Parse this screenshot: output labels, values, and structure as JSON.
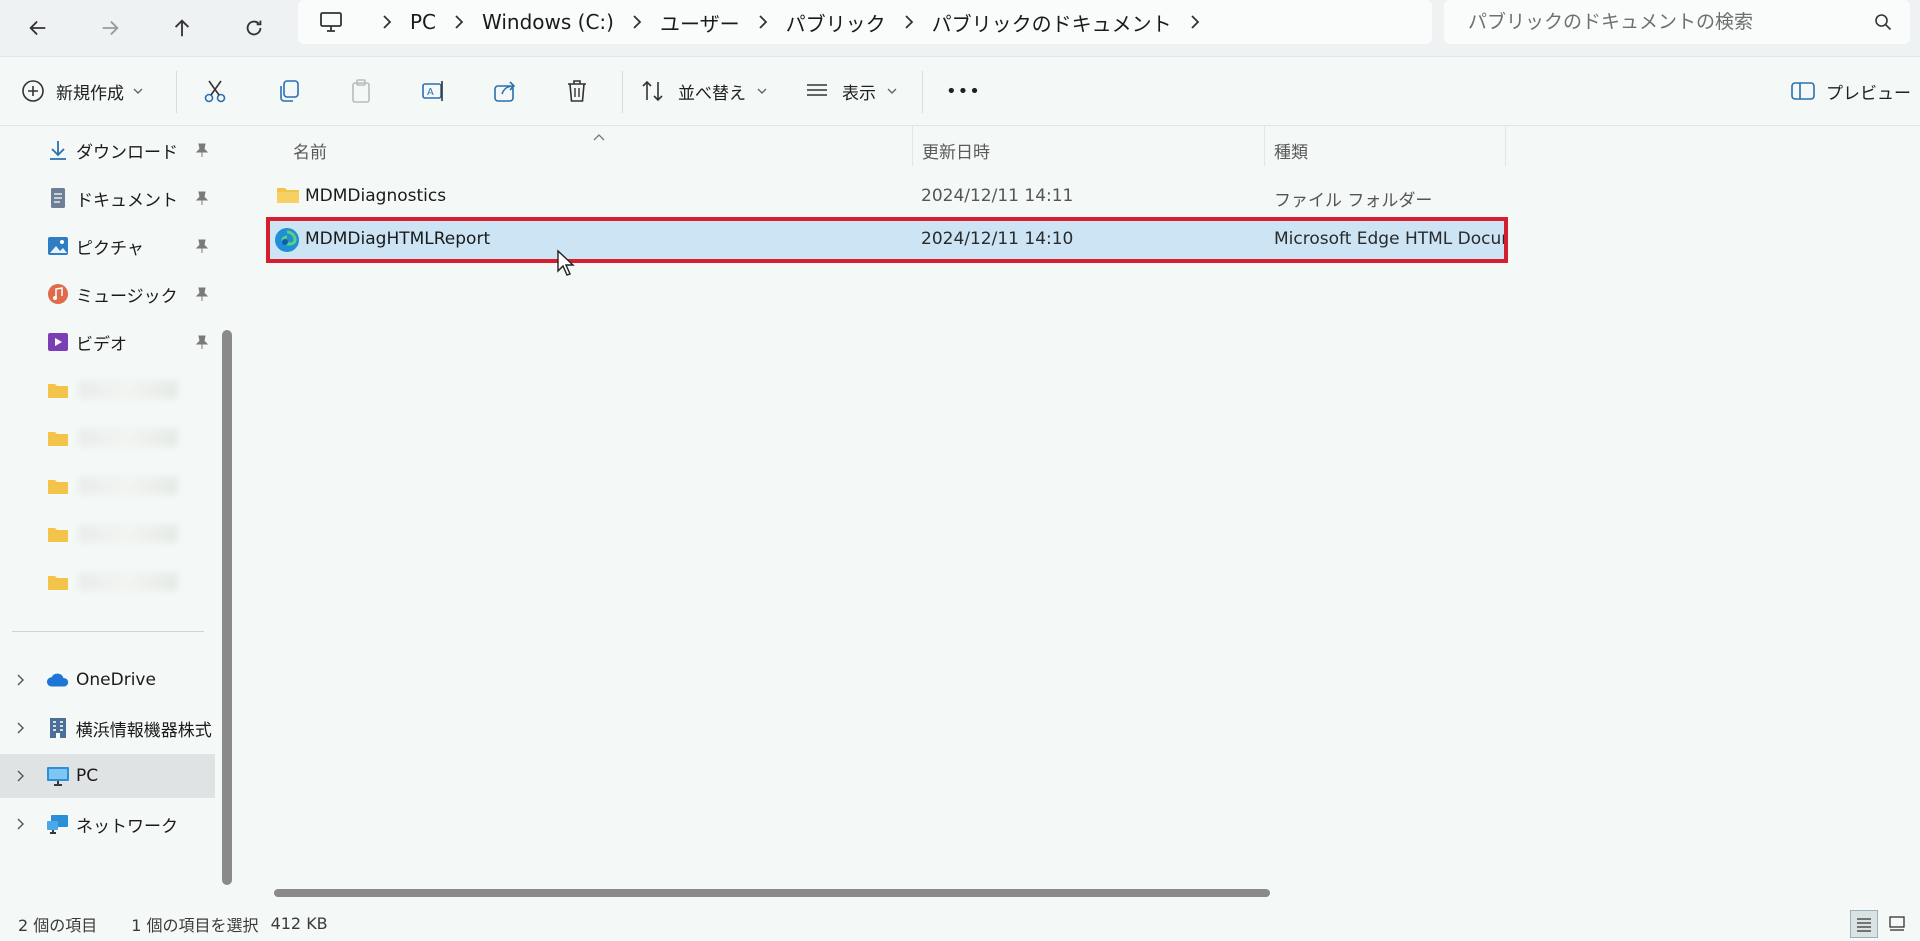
{
  "nav": {
    "back_icon": "arrow-left-icon",
    "forward_icon": "arrow-right-icon",
    "up_icon": "arrow-up-icon",
    "refresh_icon": "refresh-icon",
    "breadcrumb": [
      "PC",
      "Windows (C:)",
      "ユーザー",
      "パブリック",
      "パブリックのドキュメント"
    ],
    "search_placeholder": "パブリックのドキュメントの検索"
  },
  "toolbar": {
    "new_label": "新規作成",
    "sort_label": "並べ替え",
    "view_label": "表示",
    "more_label": "•••",
    "preview_label": "プレビュー"
  },
  "sidebar": {
    "quick_access": [
      {
        "label": "ダウンロード",
        "icon": "download-icon",
        "pinned": true
      },
      {
        "label": "ドキュメント",
        "icon": "document-icon",
        "pinned": true
      },
      {
        "label": "ピクチャ",
        "icon": "pictures-icon",
        "pinned": true
      },
      {
        "label": "ミュージック",
        "icon": "music-icon",
        "pinned": true
      },
      {
        "label": "ビデオ",
        "icon": "video-icon",
        "pinned": true
      }
    ],
    "folders_count_blurred": 5,
    "locations": [
      {
        "label": "OneDrive",
        "icon": "onedrive-icon"
      },
      {
        "label": "横浜情報機器株式",
        "icon": "building-icon"
      },
      {
        "label": "PC",
        "icon": "pc-icon",
        "selected": true
      },
      {
        "label": "ネットワーク",
        "icon": "network-icon"
      }
    ]
  },
  "columns": {
    "name": "名前",
    "modified": "更新日時",
    "type": "種類"
  },
  "files": [
    {
      "name": "MDMDiagnostics",
      "modified": "2024/12/11 14:11",
      "type": "ファイル フォルダー",
      "icon": "folder-icon",
      "selected": false
    },
    {
      "name": "MDMDiagHTMLReport",
      "modified": "2024/12/11 14:10",
      "type": "Microsoft Edge HTML Docum",
      "icon": "edge-icon",
      "selected": true
    }
  ],
  "status": {
    "item_count": "2 個の項目",
    "selection": "1 個の項目を選択",
    "size": "412 KB"
  },
  "colors": {
    "selection_bg": "#cce4f3",
    "highlight_border": "#d4202c"
  }
}
